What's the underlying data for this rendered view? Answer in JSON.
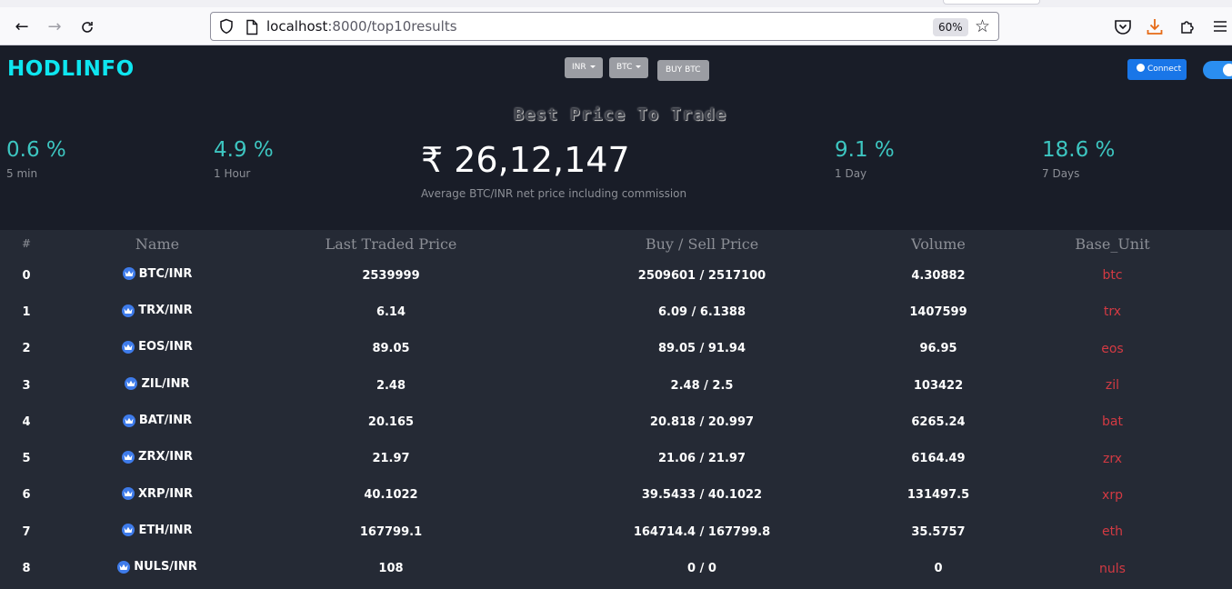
{
  "browser": {
    "url_host": "localhost",
    "url_rest": ":8000/top10results",
    "zoom": "60%"
  },
  "header": {
    "logo": "HODLINFO",
    "currency_dropdown": "INR",
    "coin_dropdown": "BTC",
    "buy_button": "BUY BTC",
    "connect_button": "Connect"
  },
  "summary": {
    "title": "Best Price To Trade",
    "stats": [
      {
        "value": "0.6 %",
        "label": "5 min"
      },
      {
        "value": "4.9 %",
        "label": "1 Hour"
      },
      {
        "value": "9.1 %",
        "label": "1 Day"
      },
      {
        "value": "18.6 %",
        "label": "7 Days"
      }
    ],
    "price": "₹ 26,12,147",
    "price_note": "Average BTC/INR net price including commission"
  },
  "table": {
    "headers": [
      "#",
      "Name",
      "Last Traded Price",
      "Buy / Sell Price",
      "Volume",
      "Base_Unit"
    ],
    "rows": [
      {
        "idx": "0",
        "name": "BTC/INR",
        "last": "2539999",
        "buysell": "2509601 / 2517100",
        "volume": "4.30882",
        "unit": "btc"
      },
      {
        "idx": "1",
        "name": "TRX/INR",
        "last": "6.14",
        "buysell": "6.09 / 6.1388",
        "volume": "1407599",
        "unit": "trx"
      },
      {
        "idx": "2",
        "name": "EOS/INR",
        "last": "89.05",
        "buysell": "89.05 / 91.94",
        "volume": "96.95",
        "unit": "eos"
      },
      {
        "idx": "3",
        "name": "ZIL/INR",
        "last": "2.48",
        "buysell": "2.48 / 2.5",
        "volume": "103422",
        "unit": "zil"
      },
      {
        "idx": "4",
        "name": "BAT/INR",
        "last": "20.165",
        "buysell": "20.818 / 20.997",
        "volume": "6265.24",
        "unit": "bat"
      },
      {
        "idx": "5",
        "name": "ZRX/INR",
        "last": "21.97",
        "buysell": "21.06 / 21.97",
        "volume": "6164.49",
        "unit": "zrx"
      },
      {
        "idx": "6",
        "name": "XRP/INR",
        "last": "40.1022",
        "buysell": "39.5433 / 40.1022",
        "volume": "131497.5",
        "unit": "xrp"
      },
      {
        "idx": "7",
        "name": "ETH/INR",
        "last": "167799.1",
        "buysell": "164714.4 / 167799.8",
        "volume": "35.5757",
        "unit": "eth"
      },
      {
        "idx": "8",
        "name": "NULS/INR",
        "last": "108",
        "buysell": "0 / 0",
        "volume": "0",
        "unit": "nuls"
      }
    ]
  },
  "colors": {
    "accent": "#3dc6c1",
    "logo": "#0ee6f0",
    "unit": "#d33a43",
    "connect": "#1976e8"
  }
}
